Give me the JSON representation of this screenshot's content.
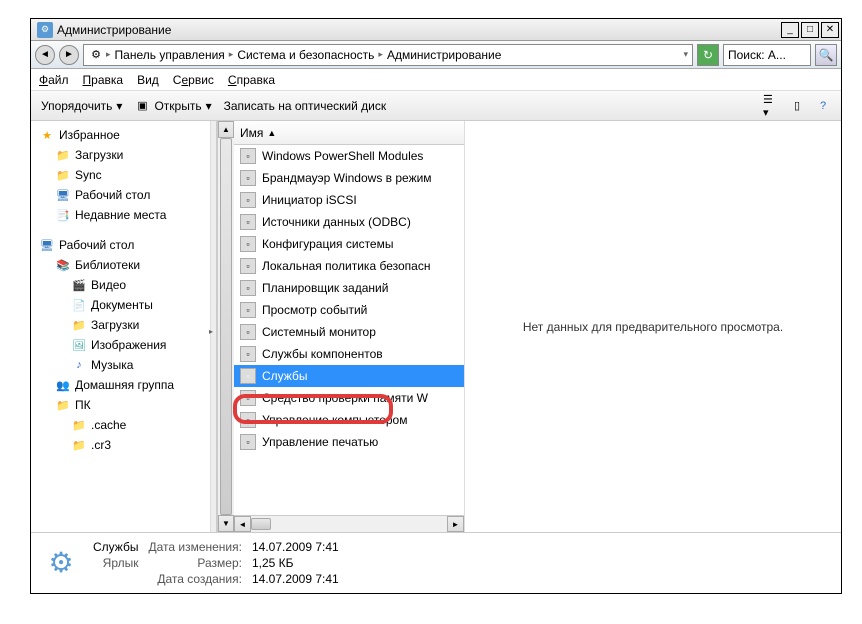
{
  "titlebar": {
    "text": "Администрирование"
  },
  "breadcrumb": {
    "p1": "Панель управления",
    "p2": "Система и безопасность",
    "p3": "Администрирование"
  },
  "search": {
    "placeholder": "Поиск: А..."
  },
  "menu": {
    "file": "Файл",
    "edit": "Правка",
    "view": "Вид",
    "tools": "Сервис",
    "help": "Справка"
  },
  "toolbar": {
    "organize": "Упорядочить",
    "open": "Открыть",
    "burn": "Записать на оптический диск"
  },
  "sidebar": {
    "favorites": "Избранное",
    "downloads": "Загрузки",
    "sync": "Sync",
    "desktop": "Рабочий стол",
    "recent": "Недавние места",
    "desktop2": "Рабочий стол",
    "libraries": "Библиотеки",
    "videos": "Видео",
    "documents": "Документы",
    "downloads2": "Загрузки",
    "pictures": "Изображения",
    "music": "Музыка",
    "homegroup": "Домашняя группа",
    "pc": "ПК",
    "cache": ".cache",
    "cr3": ".cr3"
  },
  "column": {
    "name": "Имя"
  },
  "items": [
    "Windows PowerShell Modules",
    "Брандмауэр Windows в режим",
    "Инициатор iSCSI",
    "Источники данных (ODBC)",
    "Конфигурация системы",
    "Локальная политика безопасн",
    "Планировщик заданий",
    "Просмотр событий",
    "Системный монитор",
    "Службы компонентов",
    "Службы",
    "Средство проверки памяти W",
    "Управление компьютером",
    "Управление печатью"
  ],
  "selectedIndex": 10,
  "preview": {
    "empty": "Нет данных для предварительного просмотра."
  },
  "details": {
    "name": "Службы",
    "type_label": "Ярлык",
    "modified_label": "Дата изменения:",
    "modified": "14.07.2009 7:41",
    "size_label": "Размер:",
    "size": "1,25 КБ",
    "created_label": "Дата создания:",
    "created": "14.07.2009 7:41"
  }
}
